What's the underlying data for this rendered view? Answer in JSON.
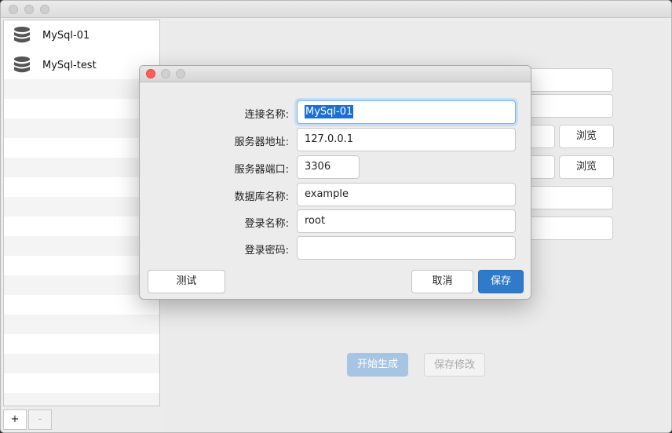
{
  "sidebar": {
    "connections": [
      {
        "name": "MySql-01",
        "icon": "database-icon"
      },
      {
        "name": "MySql-test",
        "icon": "database-icon"
      }
    ],
    "add_label": "+",
    "remove_label": "-"
  },
  "main": {
    "browse_label_1": "浏览",
    "browse_label_2": "浏览",
    "generate_label": "开始生成",
    "save_changes_label": "保存修改"
  },
  "dialog": {
    "fields": {
      "connection_name": {
        "label": "连接名称:",
        "value": "MySql-01"
      },
      "server_address": {
        "label": "服务器地址:",
        "value": "127.0.0.1"
      },
      "server_port": {
        "label": "服务器端口:",
        "value": "3306"
      },
      "database_name": {
        "label": "数据库名称:",
        "value": "example"
      },
      "login_name": {
        "label": "登录名称:",
        "value": "root"
      },
      "login_password": {
        "label": "登录密码:",
        "value": ""
      }
    },
    "test_label": "测试",
    "cancel_label": "取消",
    "save_label": "保存"
  },
  "colors": {
    "primary_button": "#2f7bc9",
    "focus_ring": "#c4dcf6",
    "selection": "#1a6fd1",
    "close_button": "#ff5f57",
    "disabled_primary": "#a7c4e2"
  }
}
